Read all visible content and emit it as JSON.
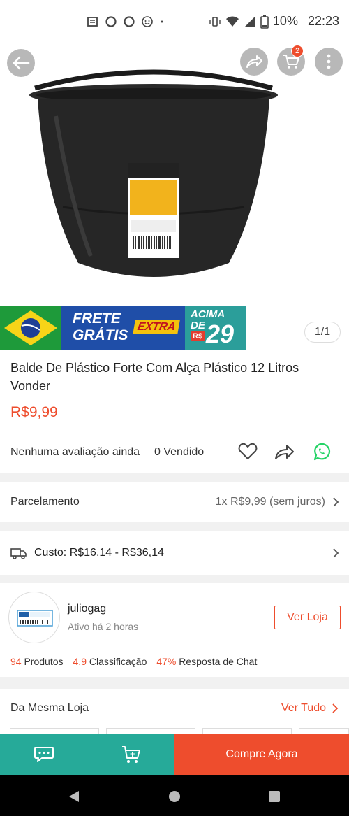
{
  "status_bar": {
    "battery": "10%",
    "time": "22:23"
  },
  "cart": {
    "badge_count": "2"
  },
  "promo_banner": {
    "free_line1": "FRETE",
    "free_line2": "GRÁTIS",
    "extra": "EXTRA",
    "above_line1": "ACIMA",
    "above_line2": "DE",
    "currency": "R$",
    "amount": "29"
  },
  "image_pager": "1/1",
  "product": {
    "title": "Balde De Plástico Forte Com Alça Plástico 12 Litros Vonder",
    "price": "R$9,99",
    "rating_text": "Nenhuma avaliação ainda",
    "sold_text": "0 Vendido"
  },
  "installments": {
    "label": "Parcelamento",
    "value": "1x R$9,99 (sem juros)"
  },
  "shipping": {
    "cost": "Custo: R$16,14 - R$36,14"
  },
  "shop": {
    "name": "juliogag",
    "active": "Ativo há 2 horas",
    "visit_button": "Ver Loja",
    "products_count": "94",
    "products_label": "Produtos",
    "rating_value": "4,9",
    "rating_label": "Classificação",
    "response_value": "47%",
    "response_label": "Resposta de Chat"
  },
  "same_store": {
    "label": "Da Mesma Loja",
    "see_all": "Ver Tudo"
  },
  "bottom_bar": {
    "buy_now": "Compre Agora"
  },
  "colors": {
    "accent": "#ee4d2d",
    "teal": "#26aa99"
  }
}
